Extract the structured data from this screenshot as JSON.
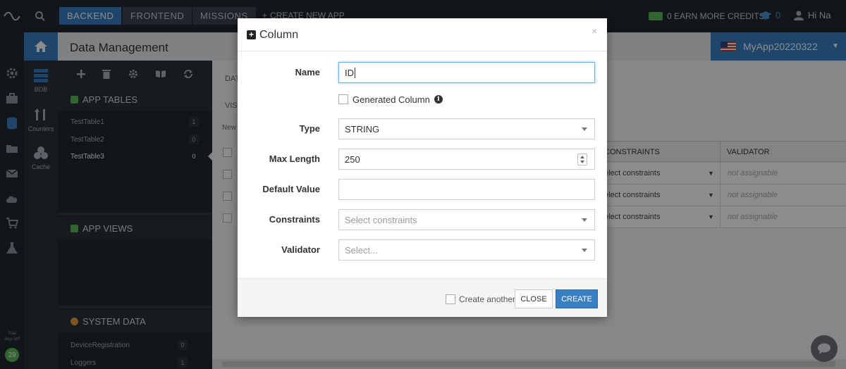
{
  "topbar": {
    "tabs": [
      {
        "label": "BACKEND",
        "active": true
      },
      {
        "label": "FRONTEND",
        "active": false
      },
      {
        "label": "MISSIONS",
        "active": false
      }
    ],
    "create_app": "CREATE NEW APP",
    "credits": "0 EARN MORE CREDITS",
    "academy_count": "0",
    "greeting": "Hi Na"
  },
  "sidebar": {
    "items": [
      {
        "label": "BDB",
        "icon": "database-icon"
      },
      {
        "label": "Counters",
        "icon": "counters-icon"
      },
      {
        "label": "Cache",
        "icon": "cache-icon"
      }
    ],
    "trial_label": "Trial\ndays left",
    "trial_days": "29"
  },
  "header": {
    "title": "Data Management",
    "app_name": "MyApp20220322"
  },
  "tables_panel": {
    "app_tables_title": "APP TABLES",
    "tables": [
      {
        "name": "TestTable1",
        "count": "1"
      },
      {
        "name": "TestTable2",
        "count": "0"
      },
      {
        "name": "TestTable3",
        "count": "0",
        "selected": true
      }
    ],
    "app_views_title": "APP VIEWS",
    "system_data_title": "SYSTEM DATA",
    "system_tables": [
      {
        "name": "DeviceRegistration",
        "count": "0"
      },
      {
        "name": "Loggers",
        "count": "1"
      }
    ]
  },
  "main": {
    "tab1": "DAT",
    "tab2": "VISU",
    "new_label": "New",
    "columns": {
      "constraints": "CONSTRAINTS",
      "validator": "VALIDATOR"
    },
    "rows": [
      {
        "constraints": "elect constraints",
        "validator": "not assignable"
      },
      {
        "constraints": "elect constraints",
        "validator": "not assignable"
      },
      {
        "constraints": "elect constraints",
        "validator": "not assignable"
      }
    ]
  },
  "modal": {
    "title": "Column",
    "close_x": "×",
    "name_label": "Name",
    "name_value": "ID",
    "generated_label": "Generated Column",
    "type_label": "Type",
    "type_value": "STRING",
    "maxlen_label": "Max Length",
    "maxlen_value": "250",
    "default_label": "Default Value",
    "default_value": "",
    "constraints_label": "Constraints",
    "constraints_placeholder": "Select constraints",
    "validator_label": "Validator",
    "validator_placeholder": "Select...",
    "create_another": "Create another",
    "close_button": "CLOSE",
    "create_button": "CREATE"
  },
  "colors": {
    "accent": "#3a7fc1",
    "dark_bg": "#22272e",
    "success": "#5cb85c"
  }
}
